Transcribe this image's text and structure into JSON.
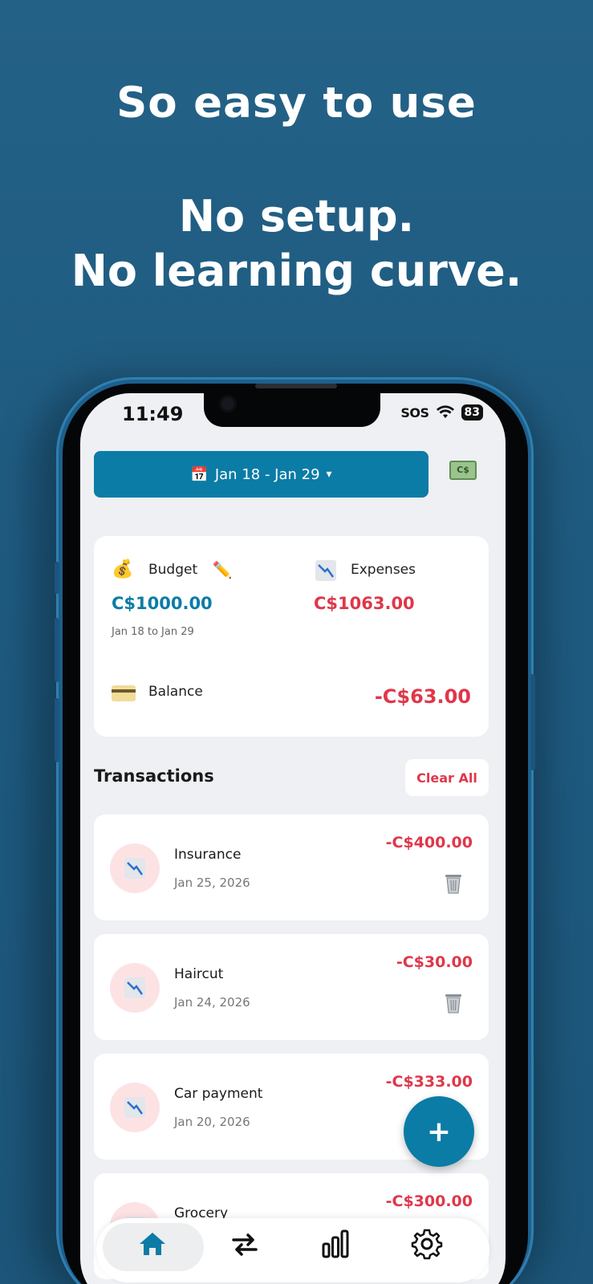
{
  "marketing": {
    "line1": "So easy to use",
    "line2": "No setup.",
    "line3": "No learning curve."
  },
  "status_bar": {
    "time": "11:49",
    "sos": "SOS",
    "battery": "83"
  },
  "header": {
    "date_range": "Jan 18 - Jan 29",
    "calendar_icon": "📅",
    "dropdown_arrow": "▾",
    "currency_icon": "C$"
  },
  "summary": {
    "budget": {
      "icon": "💰",
      "label": "Budget",
      "edit_icon": "✏️",
      "amount": "C$1000.00",
      "range": "Jan 18 to Jan 29"
    },
    "expenses": {
      "label": "Expenses",
      "amount": "C$1063.00"
    },
    "balance": {
      "label": "Balance",
      "amount": "-C$63.00"
    }
  },
  "transactions": {
    "title": "Transactions",
    "clear_all": "Clear All",
    "items": [
      {
        "name": "Insurance",
        "date": "Jan 25, 2026",
        "amount": "-C$400.00"
      },
      {
        "name": "Haircut",
        "date": "Jan 24, 2026",
        "amount": "-C$30.00"
      },
      {
        "name": "Car payment",
        "date": "Jan 20, 2026",
        "amount": "-C$333.00"
      },
      {
        "name": "Grocery",
        "date": "",
        "amount": "-C$300.00"
      }
    ]
  },
  "fab": {
    "label": "+"
  },
  "colors": {
    "accent": "#0b7ca6",
    "negative": "#e0374a",
    "background": "#246186"
  },
  "tabbar": {
    "tabs": [
      "home-icon",
      "transfer-icon",
      "chart-bars-icon",
      "gear-icon"
    ]
  }
}
